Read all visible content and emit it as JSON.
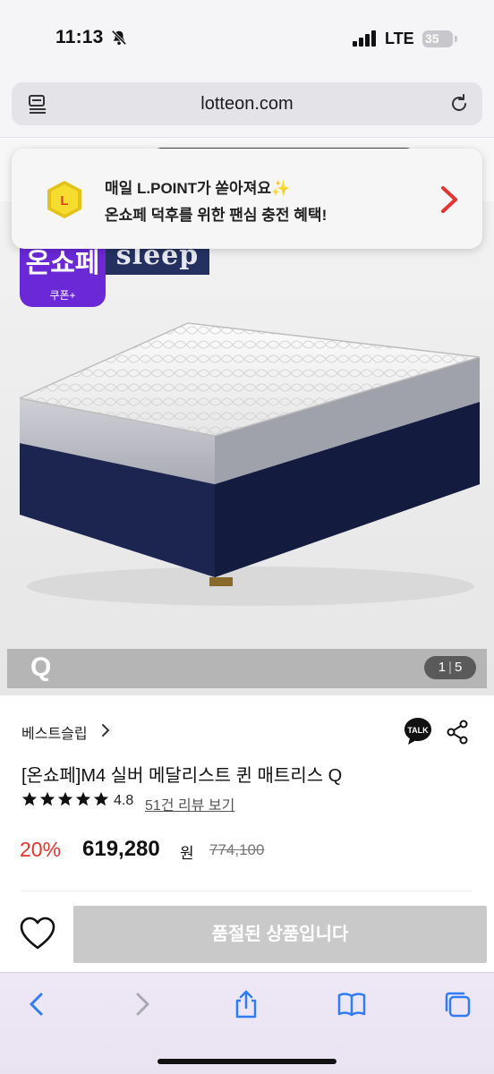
{
  "status_bar": {
    "time": "11:13",
    "network": "LTE",
    "battery": "35"
  },
  "browser": {
    "url": "lotteon.com"
  },
  "promo_banner": {
    "line1": "매일 L.POINT가 쏟아져요✨",
    "line2": "온쇼페 덕후를 위한 팬심 충전 혜택!"
  },
  "hero": {
    "badge_title": "온쇼페",
    "badge_sub": "쿠폰+",
    "brand_logo": "sleep",
    "size_label": "Q",
    "image_index": "1",
    "image_total": "5"
  },
  "product": {
    "brand": "베스트슬립",
    "title": "[온쇼페]M4 실버 메달리스트 퀸 매트리스 Q",
    "rating": "4.8",
    "rating_stars": 5,
    "reviews_link": "51건 리뷰 보기",
    "discount": "20%",
    "price": "619,280",
    "currency": "원",
    "original_price": "774,100"
  },
  "buy_bar": {
    "soldout_label": "품절된 상품입니다"
  },
  "colors": {
    "discount": "#e3342f",
    "badge": "#6a28d7",
    "ios_blue": "#2f7cf6"
  },
  "icons": [
    "bell-slash-icon",
    "signal-icon",
    "reader-icon",
    "reload-icon",
    "lpoint-icon",
    "chevron-right-icon",
    "talk-icon",
    "share-icon",
    "star-icon",
    "heart-icon",
    "back-icon",
    "forward-icon",
    "share-toolbar-icon",
    "bookmarks-icon",
    "tabs-icon"
  ]
}
